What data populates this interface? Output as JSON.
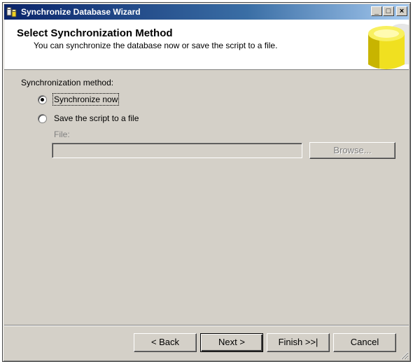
{
  "window": {
    "title": "Synchronize Database Wizard",
    "minimize_glyph": "_",
    "maximize_glyph": "□",
    "close_glyph": "×"
  },
  "header": {
    "title": "Select Synchronization Method",
    "subtitle": "You can synchronize the database now or save the script to a file.",
    "graphic_icon": "database-cylinder-icon"
  },
  "method": {
    "label": "Synchronization method:",
    "options": [
      {
        "label": "Synchronize now",
        "selected": true
      },
      {
        "label": "Save the script to a file",
        "selected": false
      }
    ]
  },
  "file": {
    "label": "File:",
    "value": "",
    "browse_label": "Browse..."
  },
  "buttons": {
    "back": "< Back",
    "next": "Next >",
    "finish": "Finish >>|",
    "cancel": "Cancel"
  },
  "colors": {
    "face": "#d4d0c8",
    "title_start": "#0a246a",
    "title_end": "#a6caf0",
    "cylinder": "#f0e020"
  }
}
